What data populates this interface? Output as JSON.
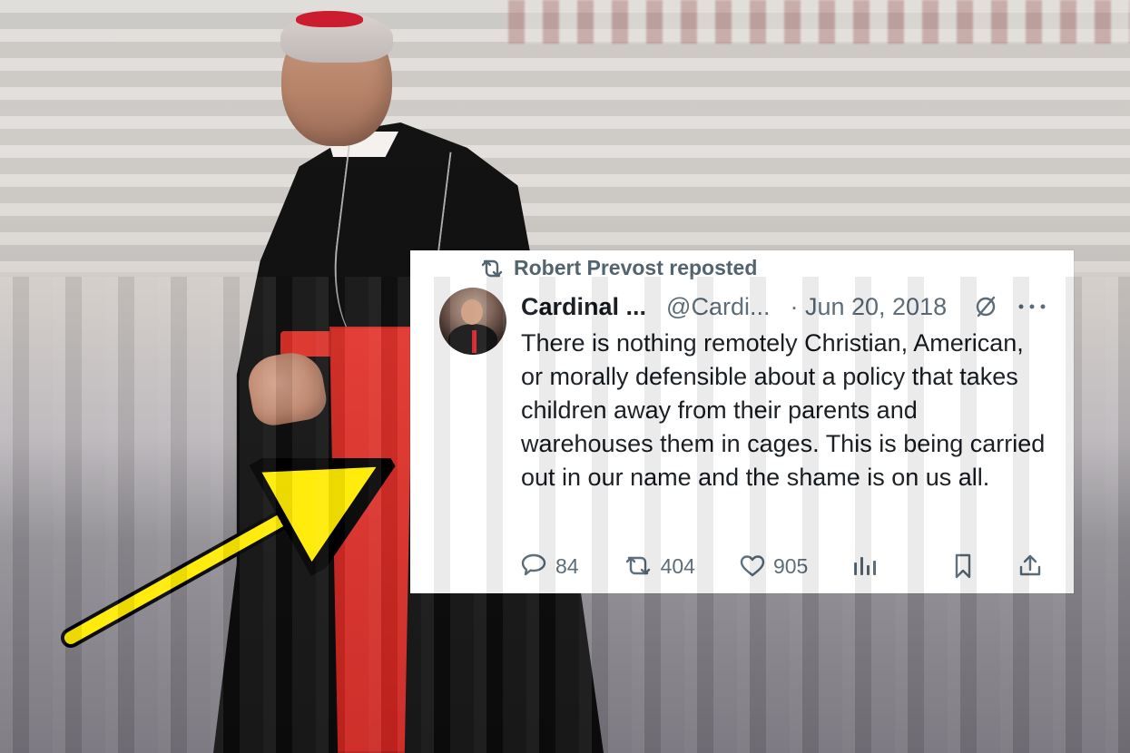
{
  "tweet": {
    "repost_label": "Robert Prevost reposted",
    "display_name": "Cardinal ...",
    "handle": "@Cardi...",
    "date": "· Jun 20, 2018",
    "text": "There is nothing remotely Christian, American, or morally defensible about a policy that takes children away from their parents and warehouses them in cages. This is being carried out in our name and the shame is on us all.",
    "actions": {
      "replies": "84",
      "reposts": "404",
      "likes": "905"
    }
  },
  "icons": {
    "repost": "repost-icon",
    "avatar": "avatar",
    "status": "slashed-circle-icon",
    "more": "more-icon",
    "reply": "reply-icon",
    "repost_action": "repost-icon",
    "like": "heart-icon",
    "views": "views-icon",
    "bookmark": "bookmark-icon",
    "share": "share-icon"
  },
  "colors": {
    "card_bg": "#ffffff",
    "text_primary": "#0f1419",
    "text_secondary": "#536471",
    "arrow_yellow": "#ffeb00",
    "sash_red": "#d92a23"
  }
}
